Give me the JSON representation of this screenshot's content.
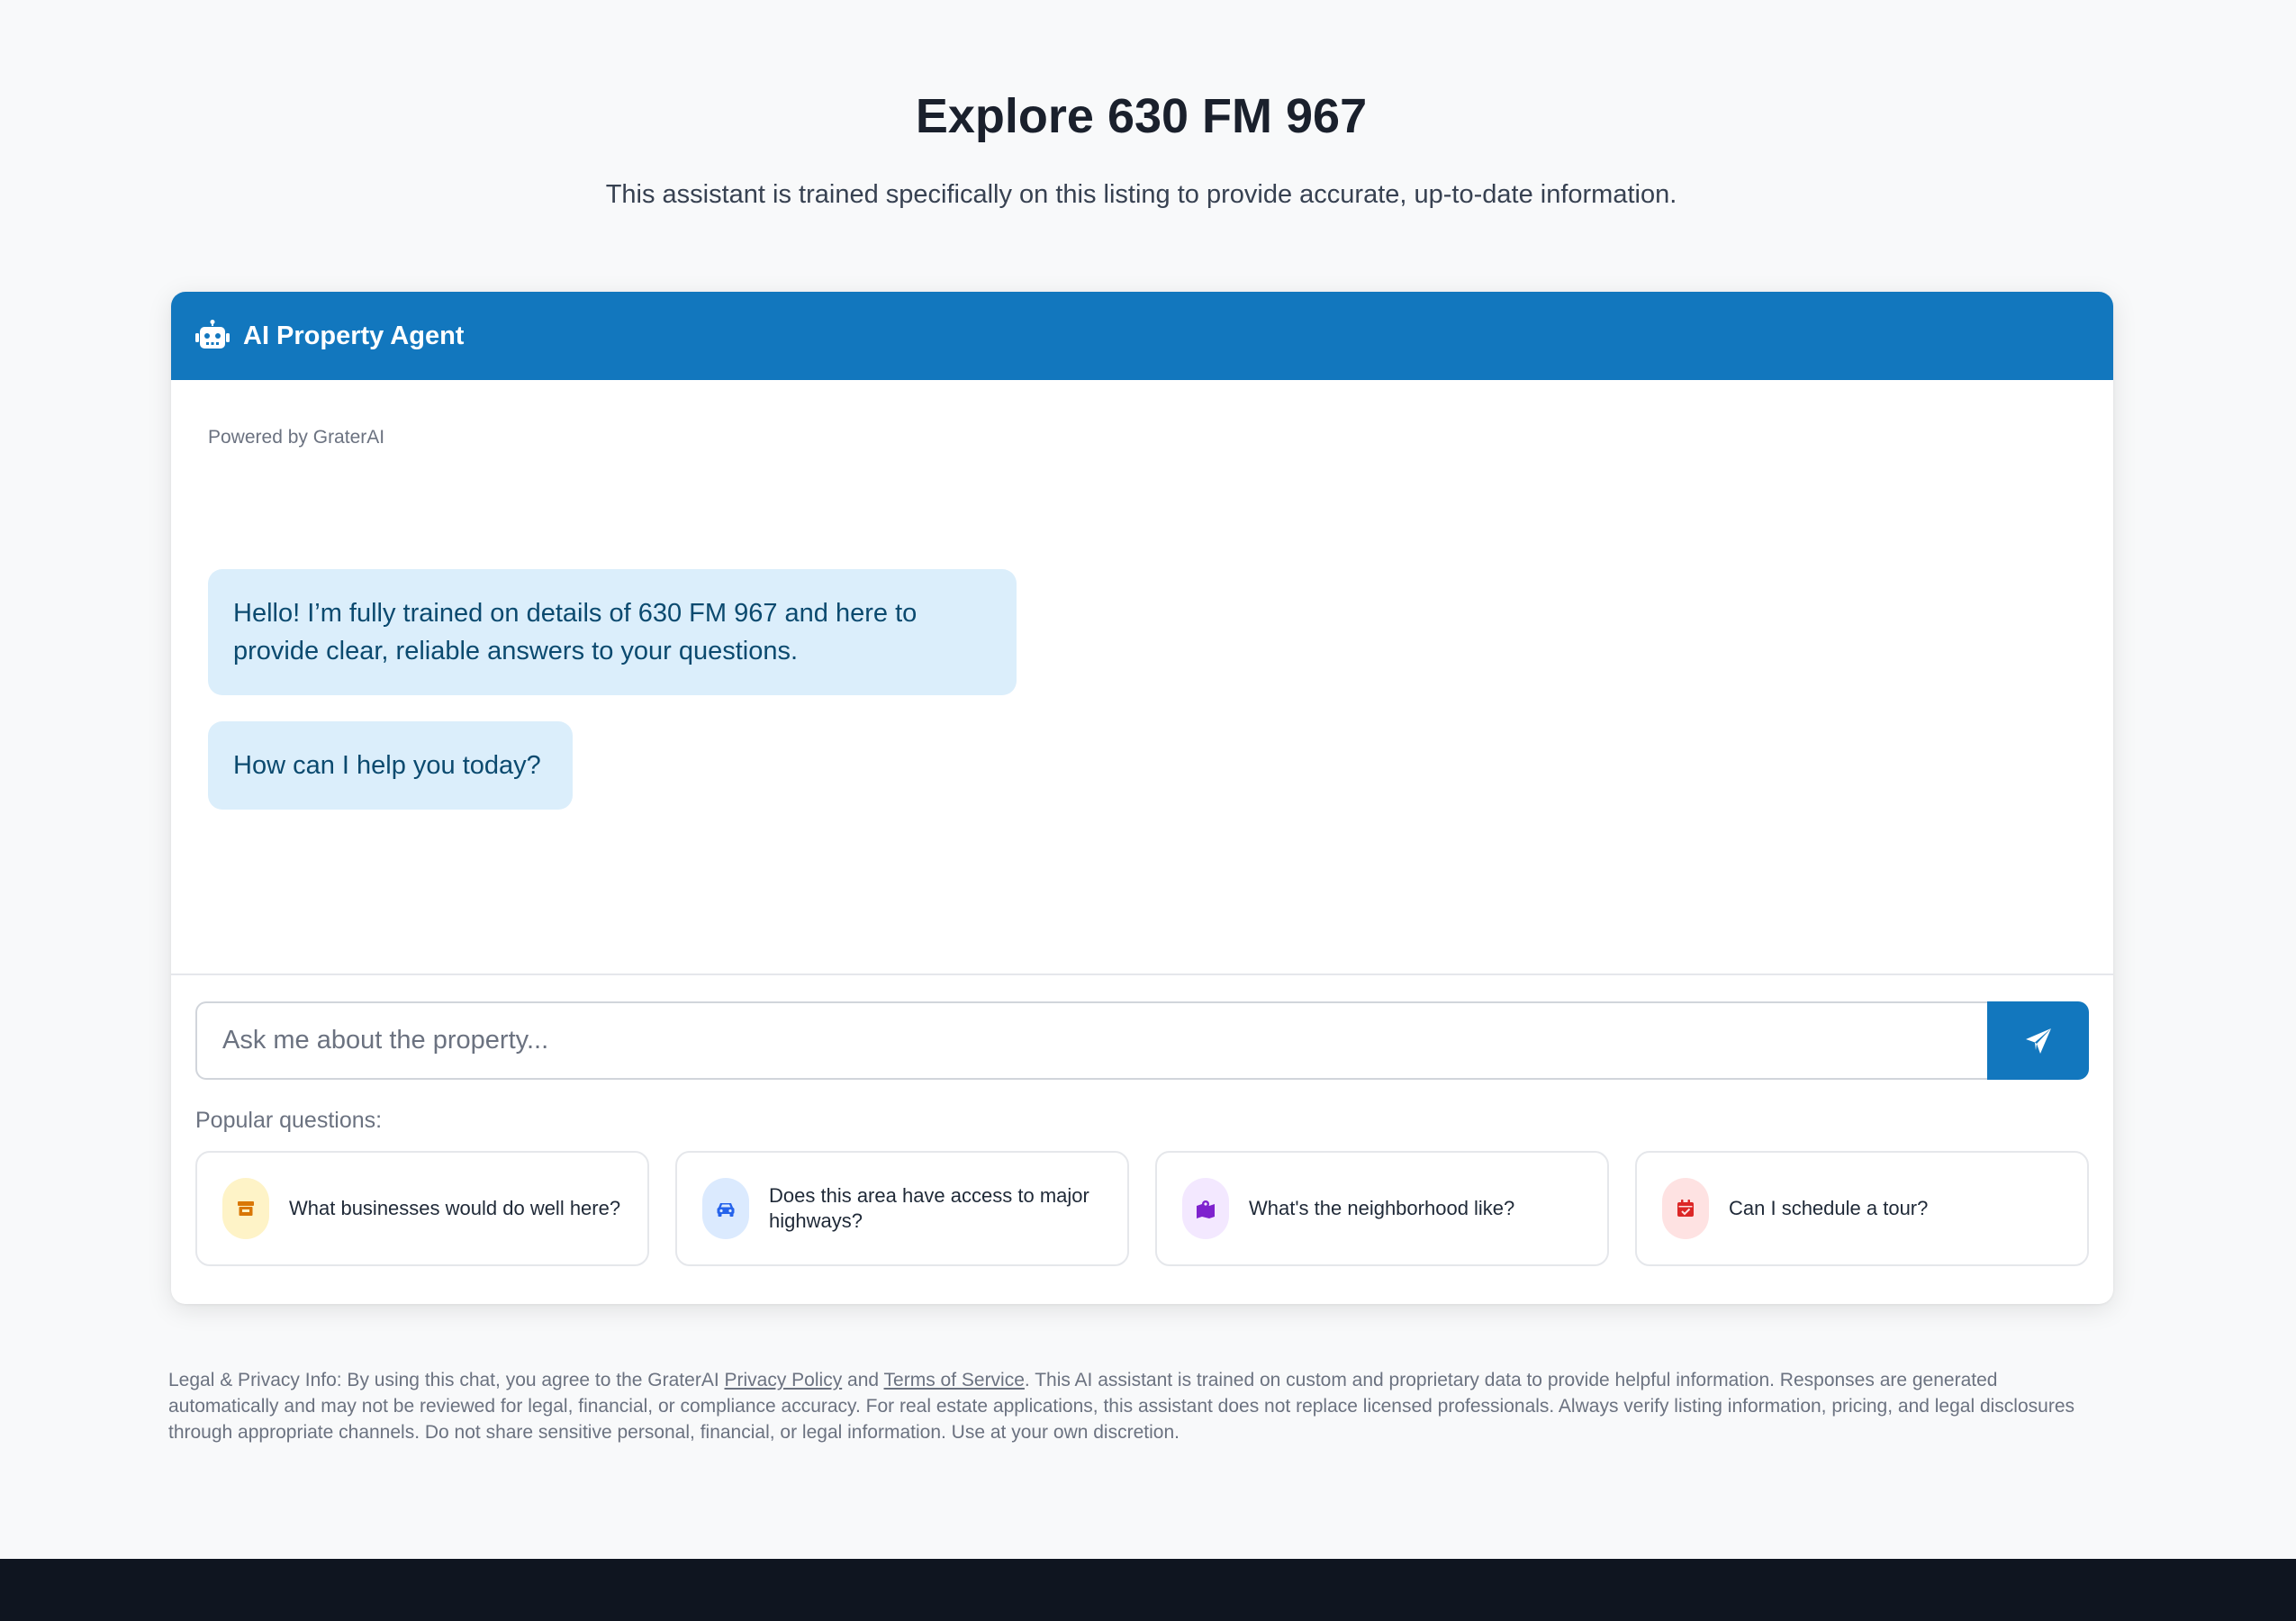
{
  "hero": {
    "title": "Explore 630 FM 967",
    "subtitle": "This assistant is trained specifically on this listing to provide accurate, up-to-date information."
  },
  "chat": {
    "header_title": "AI Property Agent",
    "header_icon": "robot-icon",
    "powered_by": "Powered by GraterAI",
    "messages": [
      {
        "text": "Hello! I’m fully trained on details of 630 FM 967 and here to provide clear, reliable answers to your questions."
      },
      {
        "text": "How can I help you today?"
      }
    ],
    "input": {
      "placeholder": "Ask me about the property...",
      "value": ""
    },
    "send_icon": "paper-plane-icon",
    "popular_label": "Popular questions:",
    "questions": [
      {
        "text": "What businesses would do well here?",
        "icon": "store-icon",
        "color": "#d97706",
        "bg": "#fef3c7"
      },
      {
        "text": "Does this area have access to major highways?",
        "icon": "car-icon",
        "color": "#2563eb",
        "bg": "#dbeafe"
      },
      {
        "text": "What's the neighborhood like?",
        "icon": "map-icon",
        "color": "#7e22ce",
        "bg": "#f3e8ff"
      },
      {
        "text": "Can I schedule a tour?",
        "icon": "calendar-icon",
        "color": "#dc2626",
        "bg": "#fee2e2"
      }
    ]
  },
  "legal": {
    "prefix": "Legal & Privacy Info: By using this chat, you agree to the GraterAI ",
    "privacy_link": "Privacy Policy",
    "and": " and ",
    "terms_link": "Terms of Service",
    "suffix": ". This AI assistant is trained on custom and proprietary data to provide helpful information. Responses are generated automatically and may not be reviewed for legal, financial, or compliance accuracy. For real estate applications, this assistant does not replace licensed professionals. Always verify listing information, pricing, and legal disclosures through appropriate channels. Do not share sensitive personal, financial, or legal information. Use at your own discretion."
  },
  "colors": {
    "accent": "#1277be",
    "bubble_bg": "#dbeefb",
    "bubble_text": "#0b4a6f",
    "footer": "#0f1520"
  }
}
